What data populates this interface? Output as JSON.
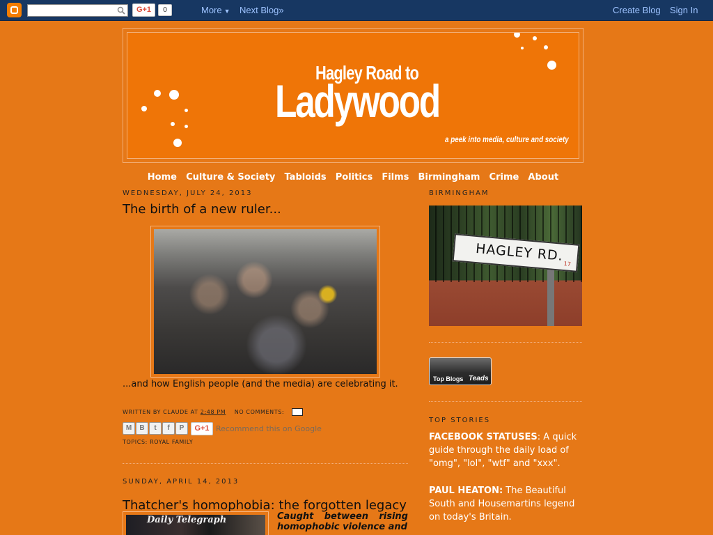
{
  "navbar": {
    "search_value": "",
    "gplus_label": "G+1",
    "gplus_count": "0",
    "more_label": "More",
    "next_blog_label": "Next Blog»",
    "create_blog_label": "Create Blog",
    "sign_in_label": "Sign In",
    "accent_color": "#173762",
    "link_color": "#9ec3ff"
  },
  "header": {
    "title_line1": "Hagley Road to",
    "title_line2": "Ladywood",
    "tagline": "a peek into media, culture and society"
  },
  "menu": [
    "Home",
    "Culture & Society",
    "Tabloids",
    "Politics",
    "Films",
    "Birmingham",
    "Crime",
    "About"
  ],
  "posts": [
    {
      "date": "Wednesday, July 24, 2013",
      "title": "The birth of a new ruler...",
      "body": "...and how English people (and the media) are celebrating it.",
      "footer_written_by": "Written by",
      "author": "Claude",
      "at": "at",
      "time": "2:48 PM",
      "comments": "No comments:",
      "share_buttons": [
        "M",
        "B",
        "t",
        "f",
        "P"
      ],
      "share_gplus": "G+1",
      "recommend": "Recommend this on Google",
      "topics_label": "Topics:",
      "topics": "Royal Family"
    },
    {
      "date": "Sunday, April 14, 2013",
      "title": "Thatcher's homophobia: the forgotten legacy",
      "image_text": "Daily Telegraph",
      "teaser": "Caught between rising homophobic violence and"
    }
  ],
  "sidebar": {
    "birmingham_title": "Birmingham",
    "sign_text": "HAGLEY RD.",
    "sign_number": "17",
    "topblogs_label": "Top Blogs",
    "teads_label": "Teads",
    "top_stories_title": "Top Stories",
    "stories": [
      {
        "headline": "FACEBOOK STATUSES",
        "text": ": A quick guide through the daily load of \"omg\", \"lol\", \"wtf\" and \"xxx\"."
      },
      {
        "headline": "PAUL HEATON:",
        "text": " The Beautiful South and Housemartins legend on today's Britain."
      }
    ]
  },
  "colors": {
    "background": "#e67817",
    "header_background": "#ef7507"
  }
}
